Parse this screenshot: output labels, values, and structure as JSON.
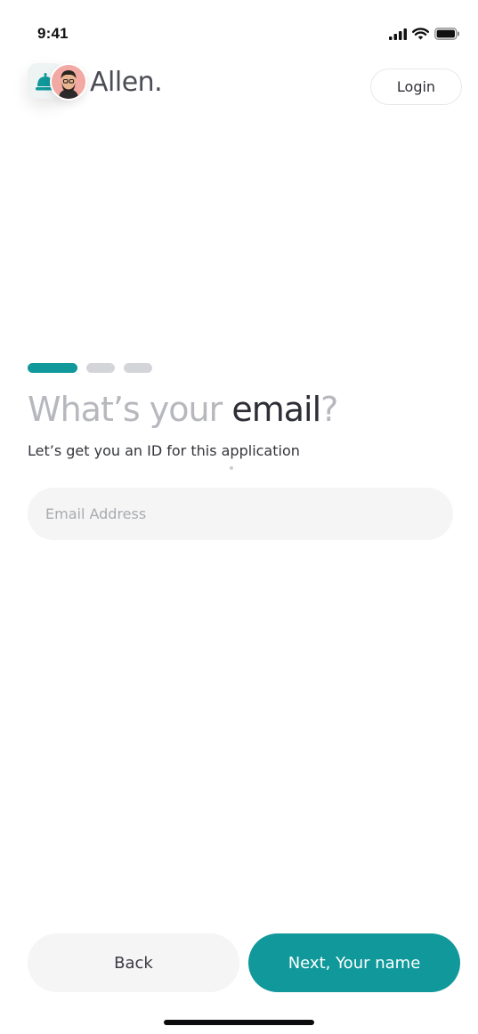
{
  "status_bar": {
    "time": "9:41",
    "icons": [
      "signal-icon",
      "wifi-icon",
      "battery-icon"
    ]
  },
  "header": {
    "brand_name": "Allen.",
    "login_label": "Login",
    "logo_icon": "bell-icon",
    "avatar_icon": "user-avatar"
  },
  "progress": {
    "total_steps": 3,
    "current_step": 1,
    "active_color": "#10989a",
    "inactive_color": "#d3d5d9"
  },
  "form": {
    "heading_prefix": "What’s your ",
    "heading_emphasis": "email",
    "heading_suffix": "?",
    "subtitle": "Let’s get you an ID for this application",
    "email_placeholder": "Email Address",
    "email_value": ""
  },
  "actions": {
    "back_label": "Back",
    "next_label": "Next, Your name"
  },
  "colors": {
    "accent": "#10989a",
    "heading_muted": "#b6b8bd",
    "heading_strong": "#2d2e36"
  }
}
